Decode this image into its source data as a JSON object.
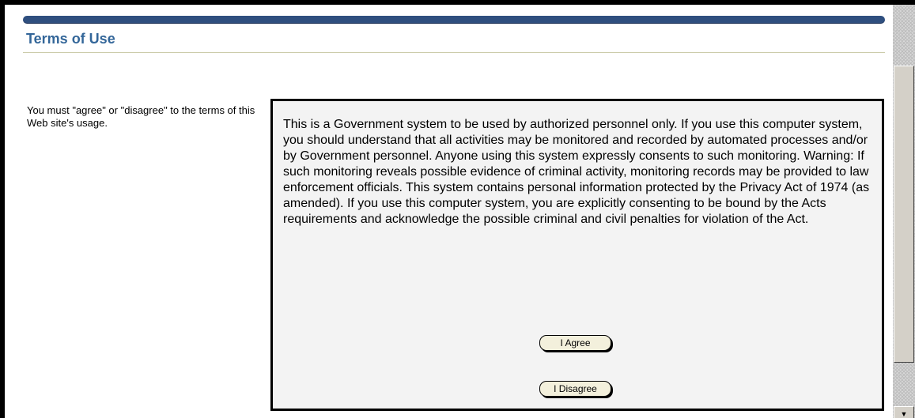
{
  "header": {
    "title": "Terms of Use"
  },
  "instruction": "You must \"agree\" or \"disagree\" to the terms of this Web site's usage.",
  "terms": {
    "text": "This is a Government system to be used by authorized personnel only. If you use this computer system, you should understand that all activities may be monitored and recorded by automated processes and/or by Government personnel. Anyone using this system expressly consents to such monitoring. Warning: If such monitoring reveals possible evidence of criminal activity, monitoring records may be provided to law enforcement officials. This system contains personal information protected by the Privacy Act of 1974 (as amended). If you use this computer system, you are explicitly consenting to be bound by the Acts requirements and acknowledge the possible criminal and civil penalties for violation of the Act.",
    "agree_label": "I Agree",
    "disagree_label": "I Disagree"
  },
  "scrollbar": {
    "down_arrow_icon": "chevron-down-icon"
  },
  "colors": {
    "top_bar": "#2f4f7f",
    "title": "#336699",
    "terms_background": "#f3f3f3",
    "button_background": "#f3f0dc"
  }
}
